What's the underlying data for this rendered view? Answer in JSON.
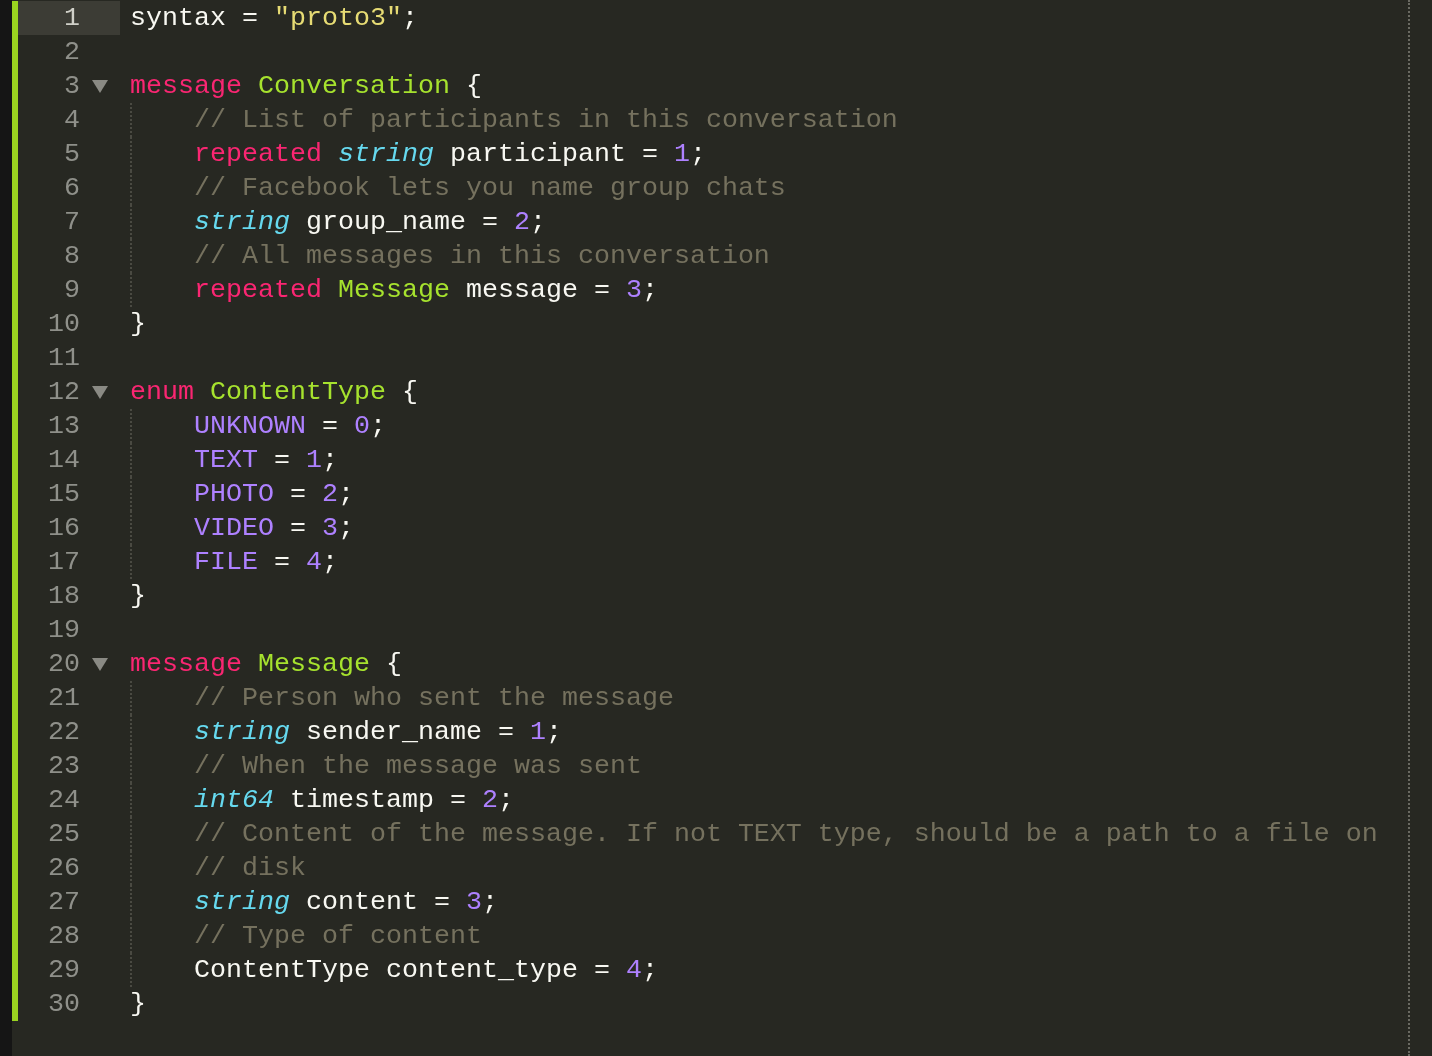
{
  "editor": {
    "lines": [
      {
        "number": "1",
        "selected": true,
        "tokens": [
          {
            "text": "syntax = ",
            "kind": "plain"
          },
          {
            "text": "\"proto3\"",
            "kind": "string"
          },
          {
            "text": ";",
            "kind": "plain"
          }
        ]
      },
      {
        "number": "2",
        "selected": false
      },
      {
        "number": "3",
        "selected": false,
        "expanded": true,
        "tokens": [
          {
            "text": "message ",
            "kind": "keyword"
          },
          {
            "text": "Conversation",
            "kind": "type"
          },
          {
            "text": " {",
            "kind": "plain"
          }
        ],
        "children": [
          {
            "number": "4",
            "selected": false,
            "tokens": [
              {
                "text": "// List of participants in this conversation",
                "kind": "comment"
              }
            ]
          },
          {
            "number": "5",
            "selected": false,
            "tokens": [
              {
                "text": "repeated ",
                "kind": "keyword"
              },
              {
                "text": "string",
                "kind": "builtin"
              },
              {
                "text": " participant = ",
                "kind": "plain"
              },
              {
                "text": "1",
                "kind": "number"
              },
              {
                "text": ";",
                "kind": "plain"
              }
            ]
          },
          {
            "number": "6",
            "selected": false,
            "tokens": [
              {
                "text": "// Facebook lets you name group chats",
                "kind": "comment"
              }
            ]
          },
          {
            "number": "7",
            "selected": false,
            "tokens": [
              {
                "text": "string",
                "kind": "builtin"
              },
              {
                "text": " group_name = ",
                "kind": "plain"
              },
              {
                "text": "2",
                "kind": "number"
              },
              {
                "text": ";",
                "kind": "plain"
              }
            ]
          },
          {
            "number": "8",
            "selected": false,
            "tokens": [
              {
                "text": "// All messages in this conversation",
                "kind": "comment"
              }
            ]
          },
          {
            "number": "9",
            "selected": false,
            "tokens": [
              {
                "text": "repeated ",
                "kind": "keyword"
              },
              {
                "text": "Message",
                "kind": "type"
              },
              {
                "text": " message = ",
                "kind": "plain"
              },
              {
                "text": "3",
                "kind": "number"
              },
              {
                "text": ";",
                "kind": "plain"
              }
            ]
          }
        ]
      },
      {
        "number": "10",
        "selected": false,
        "tokens": [
          {
            "text": "}",
            "kind": "plain"
          }
        ]
      },
      {
        "number": "11",
        "selected": false
      },
      {
        "number": "12",
        "selected": false,
        "expanded": true,
        "tokens": [
          {
            "text": "enum ",
            "kind": "keyword"
          },
          {
            "text": "ContentType",
            "kind": "type"
          },
          {
            "text": " {",
            "kind": "plain"
          }
        ],
        "children": [
          {
            "number": "13",
            "selected": false,
            "tokens": [
              {
                "text": "UNKNOWN",
                "kind": "number"
              },
              {
                "text": " = ",
                "kind": "plain"
              },
              {
                "text": "0",
                "kind": "number"
              },
              {
                "text": ";",
                "kind": "plain"
              }
            ]
          },
          {
            "number": "14",
            "selected": false,
            "tokens": [
              {
                "text": "TEXT",
                "kind": "number"
              },
              {
                "text": " = ",
                "kind": "plain"
              },
              {
                "text": "1",
                "kind": "number"
              },
              {
                "text": ";",
                "kind": "plain"
              }
            ]
          },
          {
            "number": "15",
            "selected": false,
            "tokens": [
              {
                "text": "PHOTO",
                "kind": "number"
              },
              {
                "text": " = ",
                "kind": "plain"
              },
              {
                "text": "2",
                "kind": "number"
              },
              {
                "text": ";",
                "kind": "plain"
              }
            ]
          },
          {
            "number": "16",
            "selected": false,
            "tokens": [
              {
                "text": "VIDEO",
                "kind": "number"
              },
              {
                "text": " = ",
                "kind": "plain"
              },
              {
                "text": "3",
                "kind": "number"
              },
              {
                "text": ";",
                "kind": "plain"
              }
            ]
          },
          {
            "number": "17",
            "selected": false,
            "tokens": [
              {
                "text": "FILE",
                "kind": "number"
              },
              {
                "text": " = ",
                "kind": "plain"
              },
              {
                "text": "4",
                "kind": "number"
              },
              {
                "text": ";",
                "kind": "plain"
              }
            ]
          }
        ]
      },
      {
        "number": "18",
        "selected": false,
        "tokens": [
          {
            "text": "}",
            "kind": "plain"
          }
        ]
      },
      {
        "number": "19",
        "selected": false
      },
      {
        "number": "20",
        "selected": false,
        "expanded": true,
        "tokens": [
          {
            "text": "message ",
            "kind": "keyword"
          },
          {
            "text": "Message",
            "kind": "type"
          },
          {
            "text": " {",
            "kind": "plain"
          }
        ],
        "children": [
          {
            "number": "21",
            "selected": false,
            "tokens": [
              {
                "text": "// Person who sent the message",
                "kind": "comment"
              }
            ]
          },
          {
            "number": "22",
            "selected": false,
            "tokens": [
              {
                "text": "string",
                "kind": "builtin"
              },
              {
                "text": " sender_name = ",
                "kind": "plain"
              },
              {
                "text": "1",
                "kind": "number"
              },
              {
                "text": ";",
                "kind": "plain"
              }
            ]
          },
          {
            "number": "23",
            "selected": false,
            "tokens": [
              {
                "text": "// When the message was sent",
                "kind": "comment"
              }
            ]
          },
          {
            "number": "24",
            "selected": false,
            "tokens": [
              {
                "text": "int64",
                "kind": "builtin"
              },
              {
                "text": " timestamp = ",
                "kind": "plain"
              },
              {
                "text": "2",
                "kind": "number"
              },
              {
                "text": ";",
                "kind": "plain"
              }
            ]
          },
          {
            "number": "25",
            "selected": false,
            "tokens": [
              {
                "text": "// Content of the message. If not TEXT type, should be a path to a file on",
                "kind": "comment"
              }
            ]
          },
          {
            "number": "26",
            "selected": false,
            "tokens": [
              {
                "text": "// disk",
                "kind": "comment"
              }
            ]
          },
          {
            "number": "27",
            "selected": false,
            "tokens": [
              {
                "text": "string",
                "kind": "builtin"
              },
              {
                "text": " content = ",
                "kind": "plain"
              },
              {
                "text": "3",
                "kind": "number"
              },
              {
                "text": ";",
                "kind": "plain"
              }
            ]
          },
          {
            "number": "28",
            "selected": false,
            "tokens": [
              {
                "text": "// Type of content",
                "kind": "comment"
              }
            ]
          },
          {
            "number": "29",
            "selected": false,
            "tokens": [
              {
                "text": "ContentType content_type = ",
                "kind": "plain"
              },
              {
                "text": "4",
                "kind": "number"
              },
              {
                "text": ";",
                "kind": "plain"
              }
            ]
          }
        ]
      },
      {
        "number": "30",
        "selected": false,
        "tokens": [
          {
            "text": "}",
            "kind": "plain"
          }
        ]
      }
    ]
  }
}
